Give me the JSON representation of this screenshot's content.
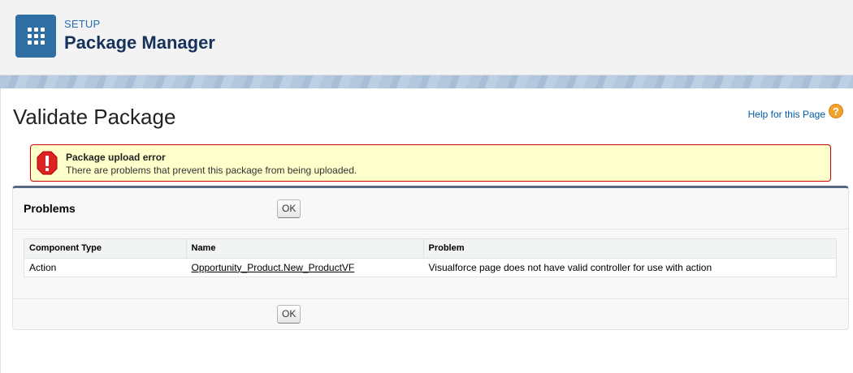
{
  "header": {
    "breadcrumb": "SETUP",
    "title": "Package Manager",
    "app_icon": "app-launcher-grid-icon"
  },
  "page": {
    "title": "Validate Package",
    "help_link": "Help for this Page",
    "help_icon": "?"
  },
  "error": {
    "title": "Package upload error",
    "message": "There are problems that prevent this package from being uploaded.",
    "icon": "error-exclamation-icon",
    "color": "#cc0000"
  },
  "problems": {
    "title": "Problems",
    "ok_label": "OK",
    "columns": [
      "Component Type",
      "Name",
      "Problem"
    ],
    "rows": [
      {
        "component_type": "Action",
        "name": "Opportunity_Product.New_ProductVF",
        "problem": "Visualforce page does not have valid controller for use with action"
      }
    ]
  },
  "colors": {
    "accent": "#2f6fa3",
    "section_border": "#56687f",
    "error_bg": "#ffffcc"
  }
}
